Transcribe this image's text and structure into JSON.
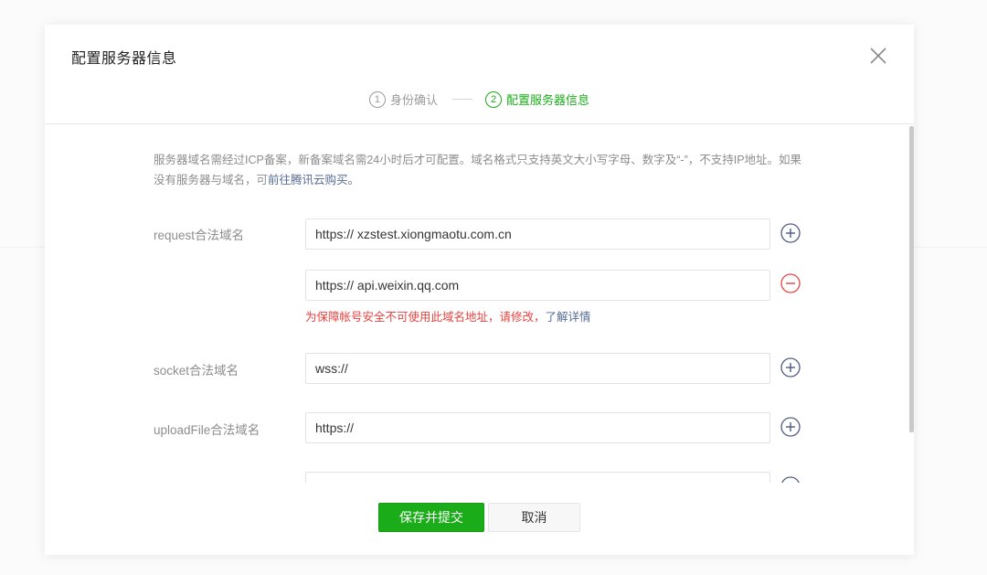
{
  "dialog": {
    "title": "配置服务器信息",
    "close_icon": "close-icon"
  },
  "steps": [
    {
      "num": "1",
      "label": "身份确认",
      "state": "done"
    },
    {
      "num": "2",
      "label": "配置服务器信息",
      "state": "active"
    }
  ],
  "notice": {
    "text": "服务器域名需经过ICP备案，新备案域名需24小时后才可配置。域名格式只支持英文大小写字母、数字及“-”，不支持IP地址。如果没有服务器与域名，可",
    "link": "前往腾讯云购买。"
  },
  "fields": {
    "request_label": "request合法域名",
    "request_value_1": "https:// xzstest.xiongmaotu.com.cn",
    "request_value_2": "https:// api.weixin.qq.com",
    "request_error": "为保障帐号安全不可使用此域名地址，请修改，",
    "request_error_link": "了解详情",
    "socket_label": "socket合法域名",
    "socket_value": "wss://",
    "upload_label": "uploadFile合法域名",
    "upload_value": "https://"
  },
  "buttons": {
    "save": "保存并提交",
    "cancel": "取消"
  },
  "colors": {
    "accent_green": "#1aad19",
    "error_red": "#e64340",
    "link_blue": "#576b95",
    "add_icon": "#4d5b84"
  }
}
